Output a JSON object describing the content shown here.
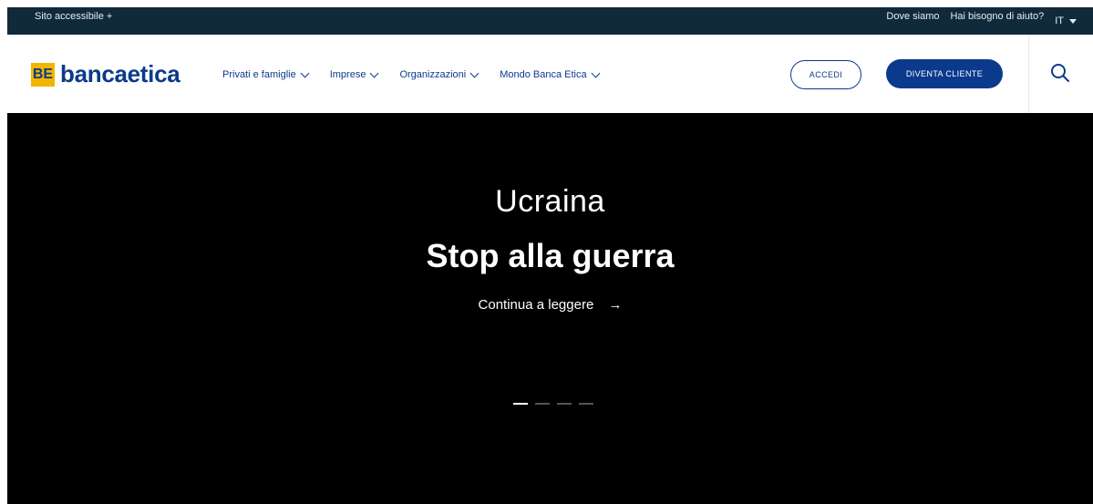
{
  "topbar": {
    "accessible": "Sito accessibile +",
    "links": [
      "Dove siamo",
      "Hai bisogno di aiuto?"
    ],
    "lang": "IT"
  },
  "header": {
    "brand": "bancaetica",
    "logo_mark": "BE",
    "nav": [
      "Privati e famiglie",
      "Imprese",
      "Organizzazioni",
      "Mondo Banca Etica"
    ],
    "accedi": "ACCEDI",
    "diventa": "DIVENTA CLIENTE"
  },
  "hero": {
    "title": "Ucraina",
    "subtitle": "Stop alla guerra",
    "link": "Continua a leggere",
    "arrow": "→",
    "slides_total": 4,
    "active_slide": 1
  },
  "colors": {
    "topbar_bg": "#102a3c",
    "brand_blue": "#0b3a8c",
    "brand_yellow": "#f2b600",
    "hero_bg": "#000000"
  },
  "icons": [
    "search-icon",
    "chevron-down-icon",
    "caret-down-icon",
    "arrow-right-icon"
  ]
}
